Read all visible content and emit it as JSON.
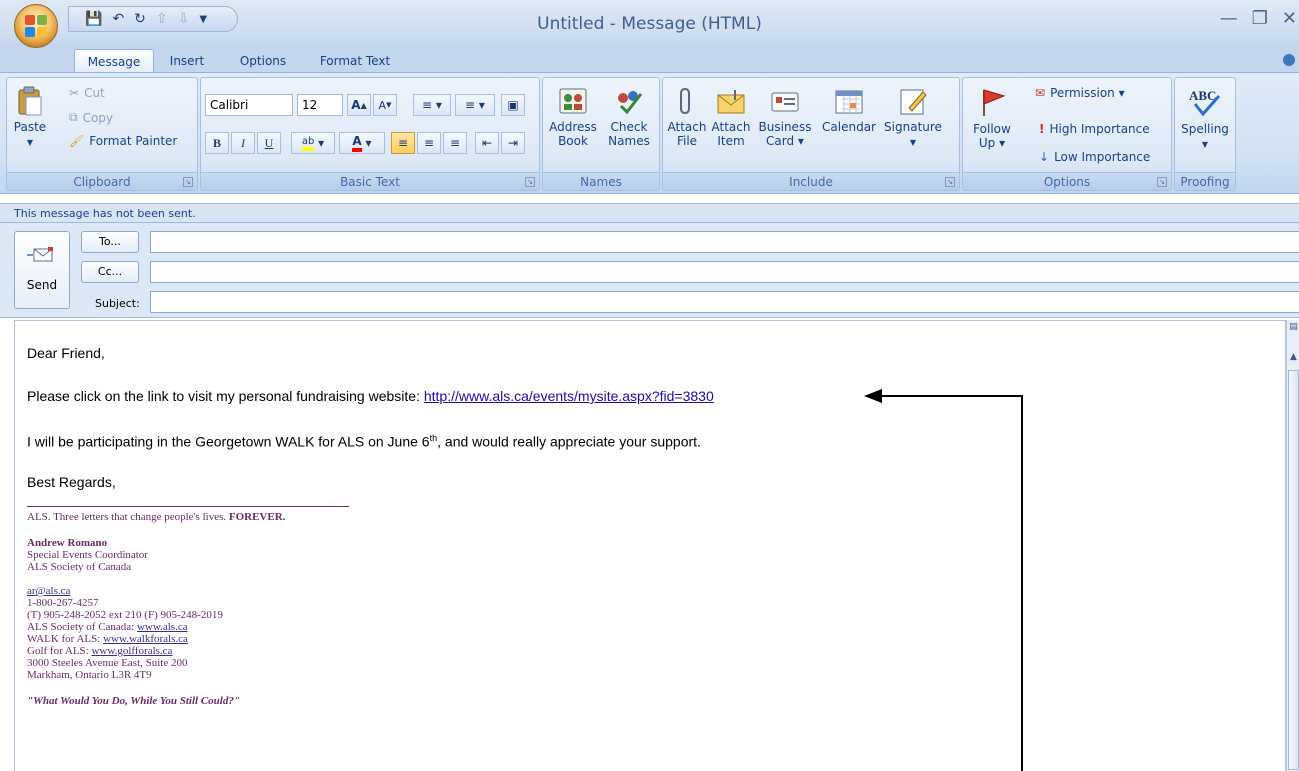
{
  "window": {
    "title": "Untitled - Message (HTML)",
    "minimize_icon": "minimize-icon",
    "restore_icon": "restore-icon",
    "close_icon": "close-icon"
  },
  "quick_access": {
    "save": "save-icon",
    "undo": "undo-icon",
    "redo": "redo-icon",
    "previous": "up-arrow-icon",
    "next": "down-arrow-icon",
    "customize": "dropdown-icon"
  },
  "tabs": [
    "Message",
    "Insert",
    "Options",
    "Format Text"
  ],
  "ribbon": {
    "clipboard": {
      "label": "Clipboard",
      "paste": "Paste",
      "cut": "Cut",
      "copy": "Copy",
      "format_painter": "Format Painter"
    },
    "basic_text": {
      "label": "Basic Text",
      "font": "Calibri",
      "size": "12",
      "bold": "B",
      "italic": "I",
      "underline": "U"
    },
    "names": {
      "label": "Names",
      "address_book_1": "Address",
      "address_book_2": "Book",
      "check_names_1": "Check",
      "check_names_2": "Names"
    },
    "include": {
      "label": "Include",
      "attach_file_1": "Attach",
      "attach_file_2": "File",
      "attach_item_1": "Attach",
      "attach_item_2": "Item",
      "business_card_1": "Business",
      "business_card_2": "Card ▾",
      "calendar": "Calendar",
      "signature": "Signature"
    },
    "options": {
      "label": "Options",
      "follow_up_1": "Follow",
      "follow_up_2": "Up ▾",
      "permission": "Permission ▾",
      "high_importance": "High Importance",
      "low_importance": "Low Importance"
    },
    "proofing": {
      "label": "Proofing",
      "spelling": "Spelling",
      "spelling_icon_text": "ABC"
    }
  },
  "infobar": "This message has not been sent.",
  "address": {
    "send": "Send",
    "to": "To...",
    "cc": "Cc...",
    "subject": "Subject:"
  },
  "message": {
    "greeting": "Dear Friend,",
    "line1_text": "Please click on the link to visit my personal fundraising website: ",
    "line1_link": "http://www.als.ca/events/mysite.aspx?fid=3830",
    "line2_a": "I will be participating in the Georgetown WALK for ALS on June 6",
    "line2_sup": "th",
    "line2_b": ", and would really appreciate your support.",
    "closing": "Best Regards,"
  },
  "signature": {
    "tagline": "ALS. Three letters that change people's lives.",
    "tagline_bold": "FOREVER.",
    "name": "Andrew Romano",
    "title": "Special Events Coordinator",
    "org": "ALS Society of Canada",
    "email": "ar@als.ca",
    "phone1": "1-800-267-4257",
    "phone2": "(T) 905-248-2052 ext 210 (F) 905-248-2019",
    "site1_label": "ALS Society of Canada: ",
    "site1_link": "www.als.ca",
    "site2_label": "WALK for ALS: ",
    "site2_link": "www.walkforals.ca",
    "site3_label": "Golf for ALS: ",
    "site3_link": "www.golfforals.ca",
    "street": "3000 Steeles Avenue East, Suite 200",
    "city": "Markham, Ontario  L3R 4T9",
    "quote": "\"What Would You Do, While You Still Could?\""
  },
  "colors": {
    "ribbon_text": "#15428b",
    "signature": "#6b2a6b",
    "link": "#1a0dab"
  }
}
